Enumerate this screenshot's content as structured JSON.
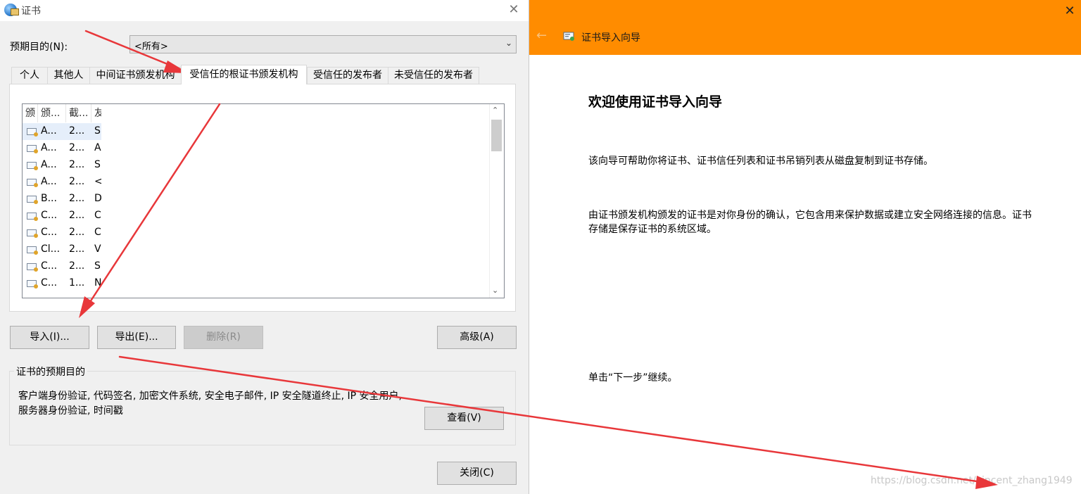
{
  "left_dialog": {
    "title": "证书",
    "purpose_label": "预期目的(N):",
    "purpose_value": "<所有>",
    "tabs": [
      {
        "label": "个人"
      },
      {
        "label": "其他人"
      },
      {
        "label": "中间证书颁发机构"
      },
      {
        "label": "受信任的根证书颁发机构",
        "active": true
      },
      {
        "label": "受信任的发布者"
      },
      {
        "label": "未受信任的发布者"
      }
    ],
    "columns": [
      "颁",
      "颁...",
      "截...",
      "友"
    ],
    "rows": [
      {
        "c1": "A...",
        "c2": "2...",
        "c3": "S"
      },
      {
        "c1": "A...",
        "c2": "2...",
        "c3": "A"
      },
      {
        "c1": "A...",
        "c2": "2...",
        "c3": "S"
      },
      {
        "c1": "A...",
        "c2": "2...",
        "c3": "<"
      },
      {
        "c1": "B...",
        "c2": "2...",
        "c3": "D"
      },
      {
        "c1": "C...",
        "c2": "2...",
        "c3": "C"
      },
      {
        "c1": "C...",
        "c2": "2...",
        "c3": "C"
      },
      {
        "c1": "Cl...",
        "c2": "2...",
        "c3": "V"
      },
      {
        "c1": "C...",
        "c2": "2...",
        "c3": "S"
      },
      {
        "c1": "C...",
        "c2": "1...",
        "c3": "N"
      }
    ],
    "buttons": {
      "import": "导入(I)...",
      "export": "导出(E)...",
      "delete": "删除(R)",
      "advanced": "高级(A)",
      "view": "查看(V)",
      "close": "关闭(C)"
    },
    "purpose_group_title": "证书的预期目的",
    "purpose_text": "客户端身份验证, 代码签名, 加密文件系统, 安全电子邮件, IP 安全隧道终止, IP 安全用户, 服务器身份验证, 时间戳"
  },
  "wizard": {
    "title": "证书导入向导",
    "heading": "欢迎使用证书导入向导",
    "p1": "该向导可帮助你将证书、证书信任列表和证书吊销列表从磁盘复制到证书存储。",
    "p2": "由证书颁发机构颁发的证书是对你身份的确认，它包含用来保护数据或建立安全网络连接的信息。证书存储是保存证书的系统区域。",
    "p3": "单击“下一步”继续。",
    "accent_color": "#ff8c00"
  },
  "watermark": "https://blog.csdn.net/vincent_zhang1949",
  "annotation_color": "#e8373a"
}
